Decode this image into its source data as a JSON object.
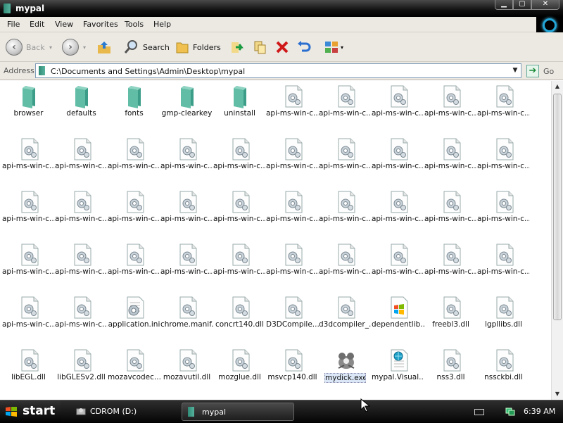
{
  "window": {
    "title": "mypal",
    "controls": {
      "minimize": "▁",
      "maximize": "▢",
      "close": "✕"
    }
  },
  "menu": [
    "File",
    "Edit",
    "View",
    "Favorites",
    "Tools",
    "Help"
  ],
  "toolbar": {
    "back": "Back",
    "search": "Search",
    "folders": "Folders"
  },
  "address": {
    "label": "Address",
    "path": "C:\\Documents and Settings\\Admin\\Desktop\\mypal",
    "go": "Go"
  },
  "files": [
    {
      "name": "browser",
      "type": "folder"
    },
    {
      "name": "defaults",
      "type": "folder"
    },
    {
      "name": "fonts",
      "type": "folder"
    },
    {
      "name": "gmp-clearkey",
      "type": "folder"
    },
    {
      "name": "uninstall",
      "type": "folder"
    },
    {
      "name": "api-ms-win-c...",
      "type": "dll"
    },
    {
      "name": "api-ms-win-c...",
      "type": "dll"
    },
    {
      "name": "api-ms-win-c...",
      "type": "dll"
    },
    {
      "name": "api-ms-win-c...",
      "type": "dll"
    },
    {
      "name": "api-ms-win-c...",
      "type": "dll"
    },
    {
      "name": "api-ms-win-c...",
      "type": "dll"
    },
    {
      "name": "api-ms-win-c...",
      "type": "dll"
    },
    {
      "name": "api-ms-win-c...",
      "type": "dll"
    },
    {
      "name": "api-ms-win-c...",
      "type": "dll"
    },
    {
      "name": "api-ms-win-c...",
      "type": "dll"
    },
    {
      "name": "api-ms-win-c...",
      "type": "dll"
    },
    {
      "name": "api-ms-win-c...",
      "type": "dll"
    },
    {
      "name": "api-ms-win-c...",
      "type": "dll"
    },
    {
      "name": "api-ms-win-c...",
      "type": "dll"
    },
    {
      "name": "api-ms-win-c...",
      "type": "dll"
    },
    {
      "name": "api-ms-win-c...",
      "type": "dll"
    },
    {
      "name": "api-ms-win-c...",
      "type": "dll"
    },
    {
      "name": "api-ms-win-c...",
      "type": "dll"
    },
    {
      "name": "api-ms-win-c...",
      "type": "dll"
    },
    {
      "name": "api-ms-win-c...",
      "type": "dll"
    },
    {
      "name": "api-ms-win-c...",
      "type": "dll"
    },
    {
      "name": "api-ms-win-c...",
      "type": "dll"
    },
    {
      "name": "api-ms-win-c...",
      "type": "dll"
    },
    {
      "name": "api-ms-win-c...",
      "type": "dll"
    },
    {
      "name": "api-ms-win-c...",
      "type": "dll"
    },
    {
      "name": "api-ms-win-c...",
      "type": "dll"
    },
    {
      "name": "api-ms-win-c...",
      "type": "dll"
    },
    {
      "name": "api-ms-win-c...",
      "type": "dll"
    },
    {
      "name": "api-ms-win-c...",
      "type": "dll"
    },
    {
      "name": "api-ms-win-c...",
      "type": "dll"
    },
    {
      "name": "api-ms-win-c...",
      "type": "dll"
    },
    {
      "name": "api-ms-win-c...",
      "type": "dll"
    },
    {
      "name": "api-ms-win-c...",
      "type": "dll"
    },
    {
      "name": "api-ms-win-c...",
      "type": "dll"
    },
    {
      "name": "api-ms-win-c...",
      "type": "dll"
    },
    {
      "name": "api-ms-win-c...",
      "type": "dll"
    },
    {
      "name": "api-ms-win-c...",
      "type": "dll"
    },
    {
      "name": "application.ini",
      "type": "ini"
    },
    {
      "name": "chrome.manif...",
      "type": "dll"
    },
    {
      "name": "concrt140.dll",
      "type": "dll"
    },
    {
      "name": "D3DCompile...",
      "type": "dll"
    },
    {
      "name": "d3dcompiler_...",
      "type": "dll"
    },
    {
      "name": "dependentlib...",
      "type": "winlist"
    },
    {
      "name": "freebl3.dll",
      "type": "dll"
    },
    {
      "name": "lgpllibs.dll",
      "type": "dll"
    },
    {
      "name": "libEGL.dll",
      "type": "dll"
    },
    {
      "name": "libGLESv2.dll",
      "type": "dll"
    },
    {
      "name": "mozavcodec...",
      "type": "dll"
    },
    {
      "name": "mozavutil.dll",
      "type": "dll"
    },
    {
      "name": "mozglue.dll",
      "type": "dll"
    },
    {
      "name": "msvcp140.dll",
      "type": "dll"
    },
    {
      "name": "mydick.exe",
      "type": "exe",
      "selected": true
    },
    {
      "name": "mypal.Visual...",
      "type": "manifest"
    },
    {
      "name": "nss3.dll",
      "type": "dll"
    },
    {
      "name": "nssckbi.dll",
      "type": "dll"
    }
  ],
  "taskbar": {
    "start": "start",
    "tasks": [
      "CDROM (D:)",
      "mypal"
    ],
    "clock": "6:39 AM"
  }
}
